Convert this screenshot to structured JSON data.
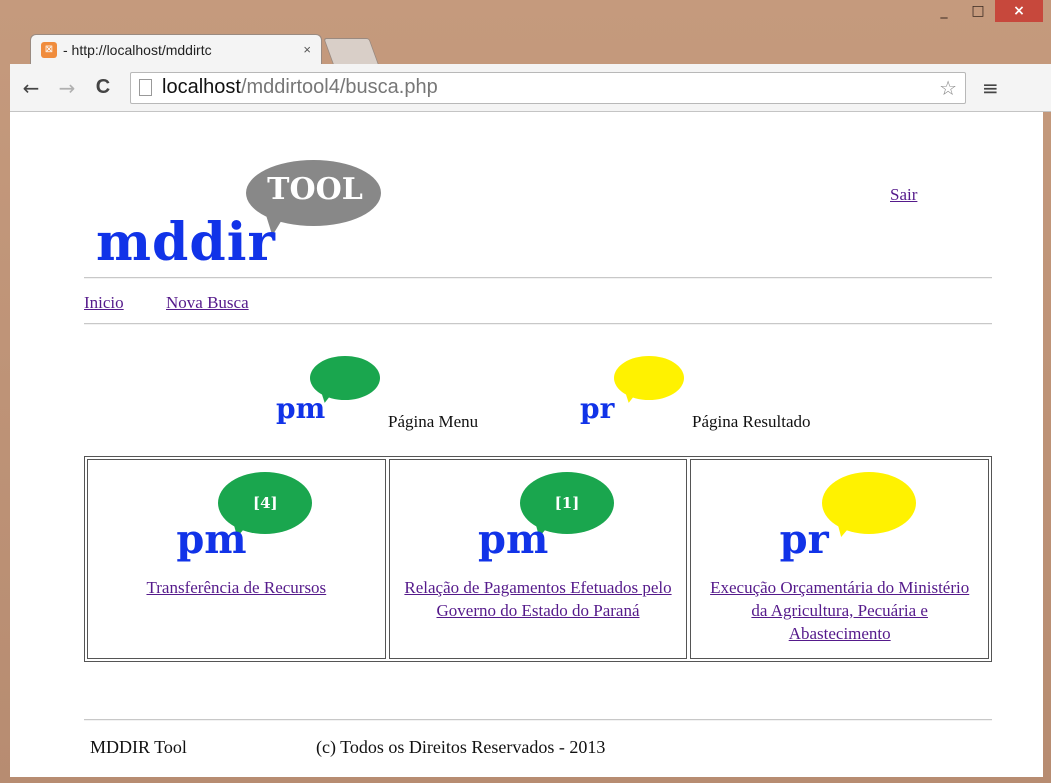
{
  "window": {
    "minimize": "_",
    "maximize": "□",
    "close": "×"
  },
  "tab": {
    "title": "- http://localhost/mddirtc",
    "close": "×"
  },
  "toolbar": {
    "back": "←",
    "forward": "→",
    "reload": "C",
    "url_host": "localhost",
    "url_path": "/mddirtool4/busca.php",
    "star": "☆",
    "menu": "≡"
  },
  "logo": {
    "bubble_text": "TOOL",
    "brand": "mddir"
  },
  "header": {
    "logout": "Sair"
  },
  "nav": {
    "home": "Inicio",
    "new_search": "Nova Busca"
  },
  "legend": [
    {
      "abbr": "pm",
      "label": "Página Menu",
      "color": "#1aa64e"
    },
    {
      "abbr": "pr",
      "label": "Página Resultado",
      "color": "#fff200"
    }
  ],
  "cards": [
    {
      "abbr": "pm",
      "badge": "[4]",
      "color": "green",
      "link": "Transferência de Recursos"
    },
    {
      "abbr": "pm",
      "badge": "[1]",
      "color": "green",
      "link": "Relação de Pagamentos Efetuados pelo Governo do Estado do Paraná"
    },
    {
      "abbr": "pr",
      "badge": "",
      "color": "yellow",
      "link": "Execução Orçamentária do Ministério da Agricultura, Pecuária e Abastecimento"
    }
  ],
  "footer": {
    "name": "MDDIR Tool",
    "copyright": "(c) Todos os Direitos Reservados - 2013"
  }
}
